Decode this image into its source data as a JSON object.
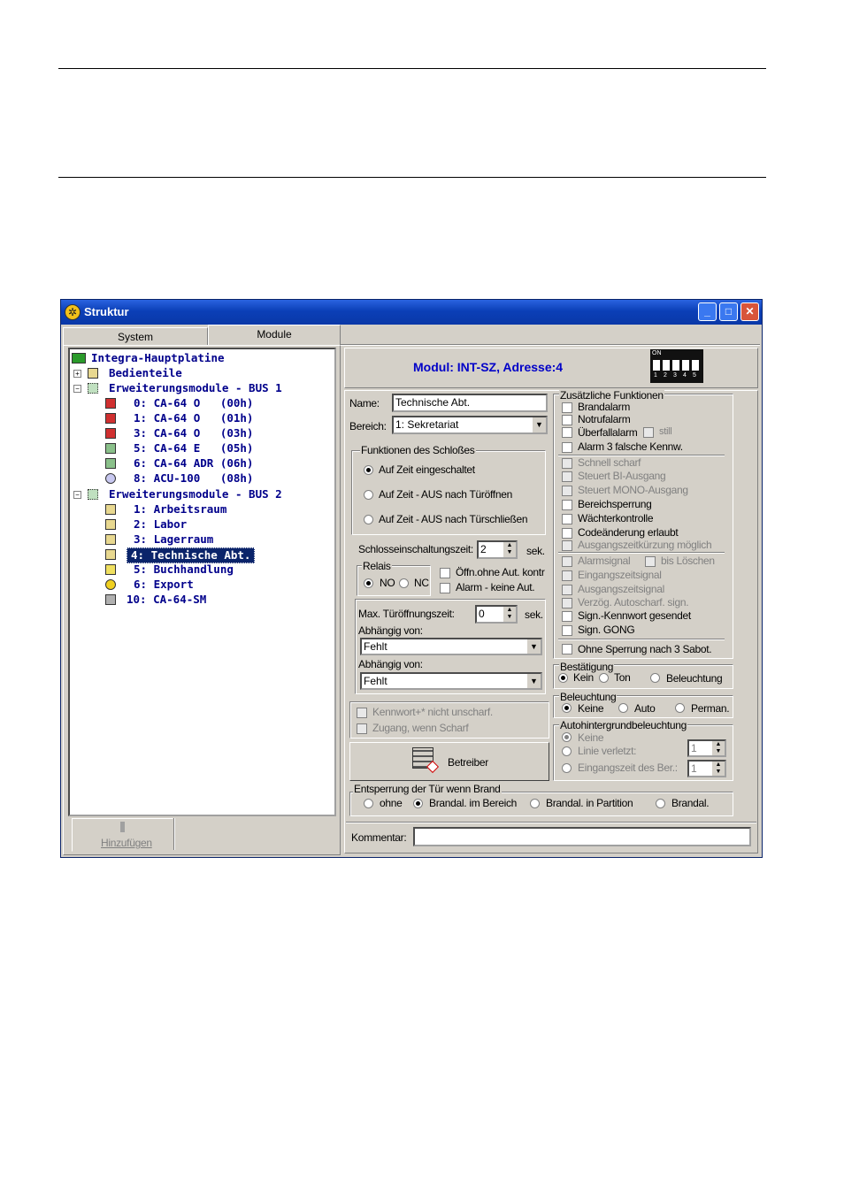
{
  "window": {
    "title": "Struktur",
    "min_label": "_",
    "max_label": "□",
    "close_label": "✕"
  },
  "tabs": [
    {
      "label": "System"
    },
    {
      "label": "Module"
    }
  ],
  "tree": {
    "root": "Integra-Hauptplatine",
    "bedienteile": "Bedienteile",
    "bus1": "Erweiterungsmodule - BUS 1",
    "bus1_items": [
      "0: CA-64 O   (00h)",
      "1: CA-64 O   (01h)",
      "3: CA-64 O   (03h)",
      "5: CA-64 E   (05h)",
      "6: CA-64 ADR (06h)",
      "8: ACU-100   (08h)"
    ],
    "bus2": "Erweiterungsmodule - BUS 2",
    "bus2_items": [
      "1: Arbeitsraum",
      "2: Labor",
      "3: Lagerraum",
      "4: Technische Abt.",
      "5: Buchhandlung",
      "6: Export",
      "10: CA-64-SM"
    ],
    "selected": "4: Technische Abt."
  },
  "add_button": {
    "label": "Hinzufügen"
  },
  "module": {
    "title": "Modul: INT-SZ, Adresse:4",
    "dip_on": "ON",
    "dip_numbers": [
      "1",
      "2",
      "3",
      "4",
      "5"
    ],
    "name_label": "Name:",
    "name_value": "Technische Abt.",
    "bereich_label": "Bereich:",
    "bereich_value": "1: Sekretariat"
  },
  "schloss": {
    "title": "Funktionen des Schloßes",
    "options": [
      "Auf Zeit eingeschaltet",
      "Auf Zeit - AUS nach Türöffnen",
      "Auf Zeit - AUS nach Türschließen"
    ]
  },
  "schlosszeit": {
    "label": "Schlosseinschaltungszeit:",
    "value": "2",
    "unit": "sek."
  },
  "relais": {
    "title": "Relais",
    "no": "NO",
    "nc": "NC"
  },
  "relais_checks": [
    "Öffn.ohne Aut. kontr",
    "Alarm - keine Aut."
  ],
  "tuerzeit": {
    "label": "Max. Türöffnungszeit:",
    "value": "0",
    "unit": "sek."
  },
  "abhaengig": [
    {
      "label": "Abhängig von:",
      "value": "Fehlt"
    },
    {
      "label": "Abhängig von:",
      "value": "Fehlt"
    }
  ],
  "kennwort": {
    "check1": "Kennwort+* nicht unscharf.",
    "check2": "Zugang, wenn Scharf"
  },
  "betreiber": {
    "label": "Betreiber"
  },
  "zusatz": {
    "title": "Zusätzliche Funktionen",
    "group1": [
      "Brandalarm",
      "Notrufalarm",
      "Überfallalarm",
      "Alarm 3 falsche Kennw."
    ],
    "still": "still",
    "group2": [
      "Schnell scharf",
      "Steuert BI-Ausgang",
      "Steuert MONO-Ausgang",
      "Bereichsperrung",
      "Wächterkontrolle",
      "Codeänderung erlaubt",
      "Ausgangszeitkürzung möglich"
    ],
    "group3": [
      "Alarmsignal",
      "Eingangszeitsignal",
      "Ausgangszeitsignal",
      "Verzög. Autoscharf. sign.",
      "Sign.-Kennwort gesendet",
      "Sign. GONG"
    ],
    "bis_loeschen": "bis Löschen",
    "sperrung": "Ohne Sperrung nach 3 Sabot."
  },
  "bestaetigung": {
    "title": "Bestätigung",
    "options": [
      "Kein",
      "Ton",
      "Beleuchtung"
    ]
  },
  "beleuchtung": {
    "title": "Beleuchtung",
    "options": [
      "Keine",
      "Auto",
      "Perman."
    ]
  },
  "autohint": {
    "title": "Autohintergrundbeleuchtung",
    "options": [
      "Keine",
      "Linie verletzt:",
      "Eingangszeit des Ber.:"
    ],
    "value1": "1",
    "value2": "1"
  },
  "brand": {
    "title": "Entsperrung der Tür wenn Brand",
    "options": [
      "ohne",
      "Brandal. im Bereich",
      "Brandal. in Partition",
      "Brandal."
    ]
  },
  "kommentar": {
    "label": "Kommentar:",
    "value": ""
  },
  "colors": {
    "title_blue": "#0b3fb7",
    "tree_text": "#00008b",
    "module_title": "#0000c8",
    "face": "#d4d0c8"
  }
}
